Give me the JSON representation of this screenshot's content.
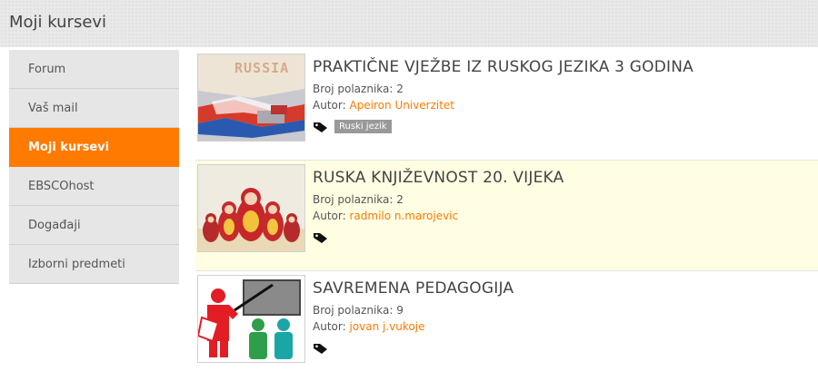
{
  "header": {
    "title": "Moji kursevi"
  },
  "sidebar": {
    "items": [
      {
        "label": "Forum"
      },
      {
        "label": "Vaš mail"
      },
      {
        "label": "Moji kursevi"
      },
      {
        "label": "EBSCOhost"
      },
      {
        "label": "Događaji"
      },
      {
        "label": "Izborni predmeti"
      }
    ],
    "active_index": 2
  },
  "courses": [
    {
      "title": "PRAKTIČNE VJEŽBE IZ RUSKOG JEZIKA 3 GODINA",
      "participants_label": "Broj polaznika:",
      "participants": "2",
      "author_label": "Autor:",
      "author": "Apeiron Univerzitet",
      "tag": "Ruski jezik",
      "thumb_text": "RUSSIA"
    },
    {
      "title": "RUSKA KNJIŽEVNOST 20. VIJEKA",
      "participants_label": "Broj polaznika:",
      "participants": "2",
      "author_label": "Autor:",
      "author": "radmilo n.marojevic"
    },
    {
      "title": "SAVREMENA PEDAGOGIJA",
      "participants_label": "Broj polaznika:",
      "participants": "9",
      "author_label": "Autor:",
      "author": "jovan j.vukoje"
    }
  ],
  "colors": {
    "accent": "#ff7a00",
    "highlight_row": "#fffee3",
    "sidebar_bg": "#e6e6e6"
  },
  "icons": {
    "tag": "tag-icon"
  }
}
